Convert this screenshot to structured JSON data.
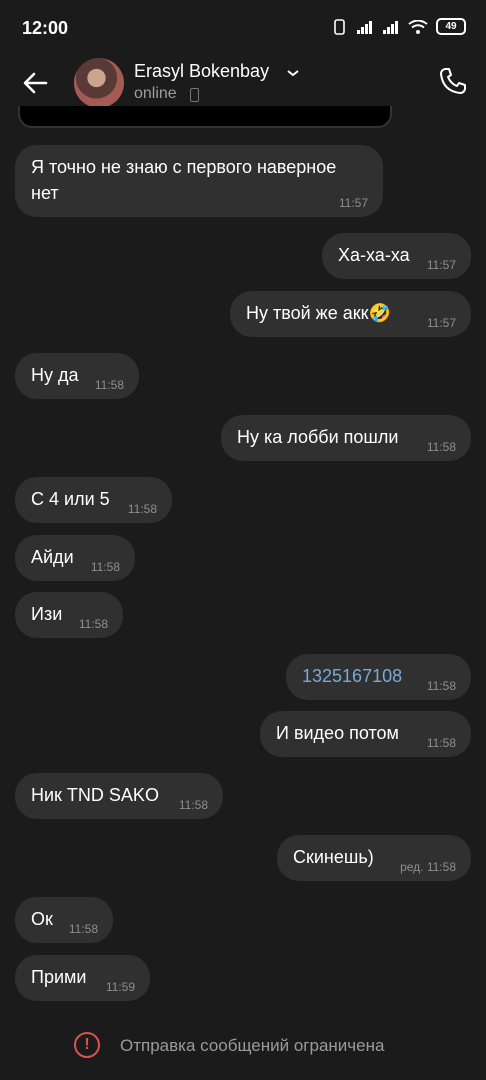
{
  "status_bar": {
    "time": "12:00",
    "battery": "49"
  },
  "header": {
    "contact_name": "Erasyl Bokenbay",
    "status": "online"
  },
  "messages": [
    {
      "text": "Я точно не знаю с первого наверное нет",
      "time": "11:57",
      "side": "in"
    },
    {
      "text": "Ха-ха-ха",
      "time": "11:57",
      "side": "out"
    },
    {
      "text": "Ну твой же акк🤣",
      "time": "11:57",
      "side": "out"
    },
    {
      "text": "Ну да",
      "time": "11:58",
      "side": "in"
    },
    {
      "text": "Ну ка лобби пошли",
      "time": "11:58",
      "side": "out"
    },
    {
      "text": "С 4 или 5",
      "time": "11:58",
      "side": "in"
    },
    {
      "text": "Айди",
      "time": "11:58",
      "side": "in"
    },
    {
      "text": "Изи",
      "time": "11:58",
      "side": "in"
    },
    {
      "text": "1325167108",
      "time": "11:58",
      "side": "out"
    },
    {
      "text": "И видео потом",
      "time": "11:58",
      "side": "out"
    },
    {
      "text": "Ник TND SAKO",
      "time": "11:58",
      "side": "in"
    },
    {
      "text": "Скинешь)",
      "time": "ред. 11:58",
      "side": "out"
    },
    {
      "text": "Ок",
      "time": "11:58",
      "side": "in"
    },
    {
      "text": "Прими",
      "time": "11:59",
      "side": "in"
    }
  ],
  "footer": {
    "notice": "Отправка сообщений ограничена"
  },
  "colors": {
    "background": "#1b1b1b",
    "bubble": "#303030",
    "link": "#7aa9d9",
    "warning": "#d9534f"
  }
}
